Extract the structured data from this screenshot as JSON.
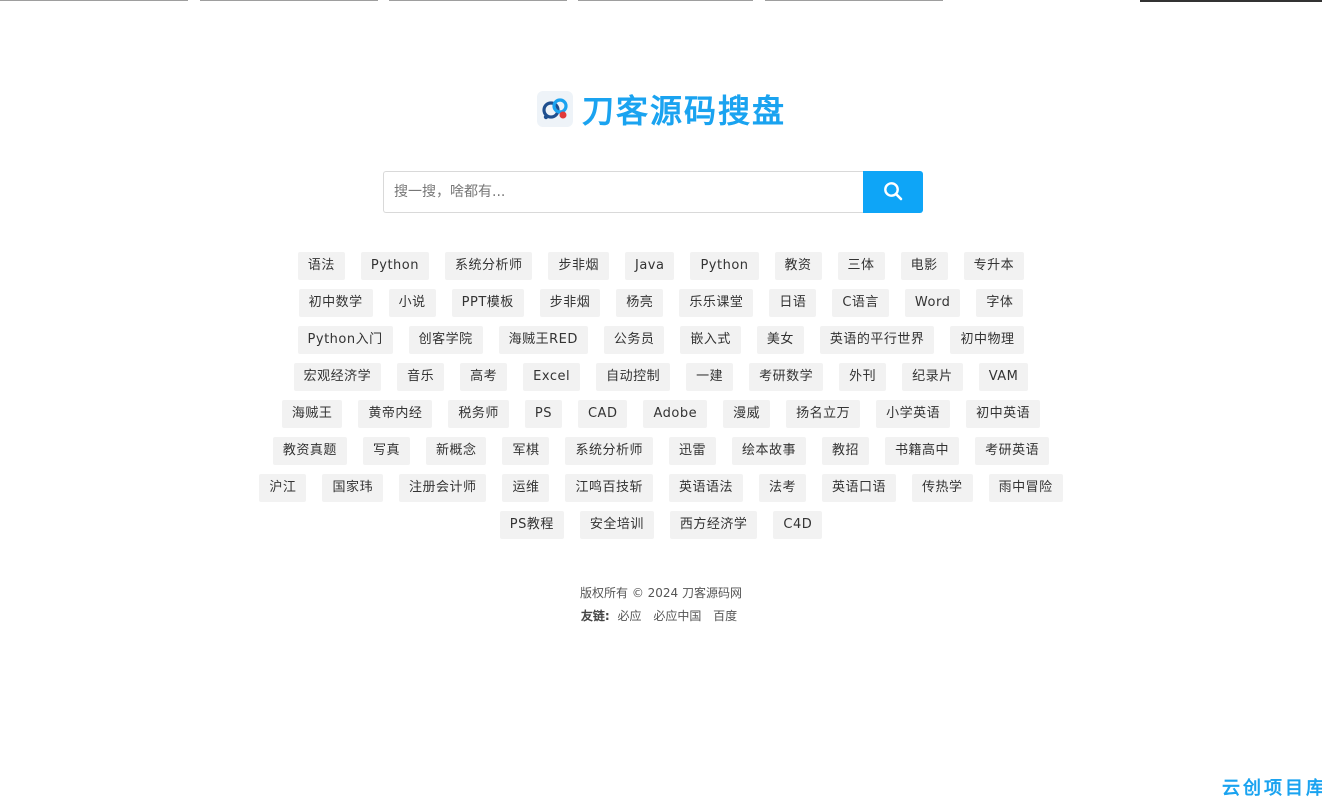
{
  "brand": {
    "name": "刀客源码搜盘",
    "accent_color": "#1aa3f0",
    "logo_icon": "cloud-link-icon"
  },
  "search": {
    "placeholder": "搜一搜，啥都有...",
    "value": "",
    "button_icon": "search-icon",
    "button_color": "#0ea5f7"
  },
  "tag_rows": [
    [
      "语法",
      "Python",
      "系统分析师",
      "步非烟",
      "Java",
      "Python",
      "教资",
      "三体",
      "电影",
      "专升本"
    ],
    [
      "初中数学",
      "小说",
      "PPT模板",
      "步非烟",
      "杨亮",
      "乐乐课堂",
      "日语",
      "C语言",
      "Word",
      "字体"
    ],
    [
      "Python入门",
      "创客学院",
      "海贼王RED",
      "公务员",
      "嵌入式",
      "美女",
      "英语的平行世界",
      "初中物理"
    ],
    [
      "宏观经济学",
      "音乐",
      "高考",
      "Excel",
      "自动控制",
      "一建",
      "考研数学",
      "外刊",
      "纪录片",
      "VAM"
    ],
    [
      "海贼王",
      "黄帝内经",
      "税务师",
      "PS",
      "CAD",
      "Adobe",
      "漫威",
      "扬名立万",
      "小学英语",
      "初中英语"
    ],
    [
      "教资真题",
      "写真",
      "新概念",
      "军棋",
      "系统分析师",
      "迅雷",
      "绘本故事",
      "教招",
      "书籍高中",
      "考研英语"
    ],
    [
      "沪江",
      "国家玮",
      "注册会计师",
      "运维",
      "江鸣百技斩",
      "英语语法",
      "法考",
      "英语口语",
      "传热学",
      "雨中冒险"
    ],
    [
      "PS教程",
      "安全培训",
      "西方经济学",
      "C4D"
    ]
  ],
  "footer": {
    "copyright": "版权所有 © 2024 刀客源码网",
    "links_label": "友链:",
    "links": [
      "必应",
      "必应中国",
      "百度"
    ]
  },
  "watermark": "云创项目库"
}
